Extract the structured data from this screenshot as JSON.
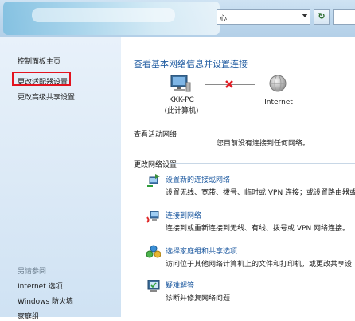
{
  "address_bar": {
    "value": "心"
  },
  "sidebar": {
    "home": "控制面板主页",
    "change_adapter": "更改适配器设置",
    "change_sharing": "更改高级共享设置",
    "see_also_title": "另请参阅",
    "see_also": [
      "Internet 选项",
      "Windows 防火墙",
      "家庭组"
    ]
  },
  "main": {
    "heading": "查看基本网络信息并设置连接",
    "computer_name": "KKK-PC",
    "computer_sub": "(此计算机)",
    "internet_label": "Internet",
    "active_title": "查看活动网络",
    "no_connection": "您目前没有连接到任何网络。",
    "change_title": "更改网络设置",
    "tasks": [
      {
        "link": "设置新的连接或网络",
        "desc": "设置无线、宽带、拨号、临时或 VPN 连接；或设置路由器或"
      },
      {
        "link": "连接到网络",
        "desc": "连接到或重新连接到无线、有线、拨号或 VPN 网络连接。"
      },
      {
        "link": "选择家庭组和共享选项",
        "desc": "访问位于其他网络计算机上的文件和打印机，或更改共享设"
      },
      {
        "link": "疑难解答",
        "desc": "诊断并修复网络问题"
      }
    ]
  },
  "colors": {
    "link": "#1e5aa0",
    "highlight_box": "#e3131f",
    "sidebar": "#dbe9f6"
  }
}
